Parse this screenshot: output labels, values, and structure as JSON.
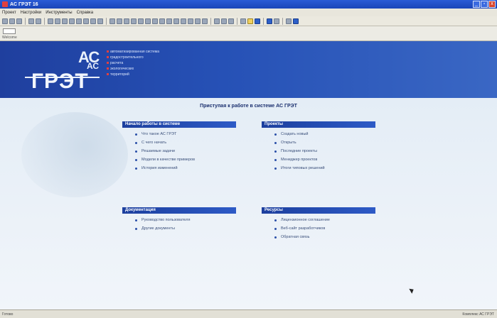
{
  "window": {
    "title": "AC ГРЭТ 16"
  },
  "menu": [
    "Проект",
    "Настройки",
    "Инструменты",
    "Справка"
  ],
  "address": {
    "label": "Welcome"
  },
  "banner": {
    "logo_ac": "АС",
    "logo_ac2": "АС",
    "logo_name": "ГРЭТ",
    "lines": [
      "автоматизированная система",
      "градостроительного",
      "расчета",
      "экологических",
      "территорий"
    ]
  },
  "welcome_title": "Приступая к работе в системе АС ГРЭТ",
  "panels": {
    "start": {
      "title": "Начало работы в системе",
      "items": [
        "Что такое АС ГРЭТ",
        "С чего начать",
        "Решаемые задачи",
        "Модели в качестве примеров",
        "История изменений"
      ]
    },
    "projects": {
      "title": "Проекты",
      "items": [
        "Создать новый",
        "Открыть",
        "Последние проекты",
        "Менеджер проектов",
        "Итоги типовых решений"
      ]
    },
    "docs": {
      "title": "Документация",
      "items": [
        "Руководство пользователя",
        "Другие документы"
      ]
    },
    "resources": {
      "title": "Ресурсы",
      "items": [
        "Лицензионное соглашение",
        "Веб-сайт разработчиков",
        "Обратная связь"
      ]
    }
  },
  "status": {
    "left": "Готово",
    "right": "Комплекс АС ГРЭТ"
  }
}
